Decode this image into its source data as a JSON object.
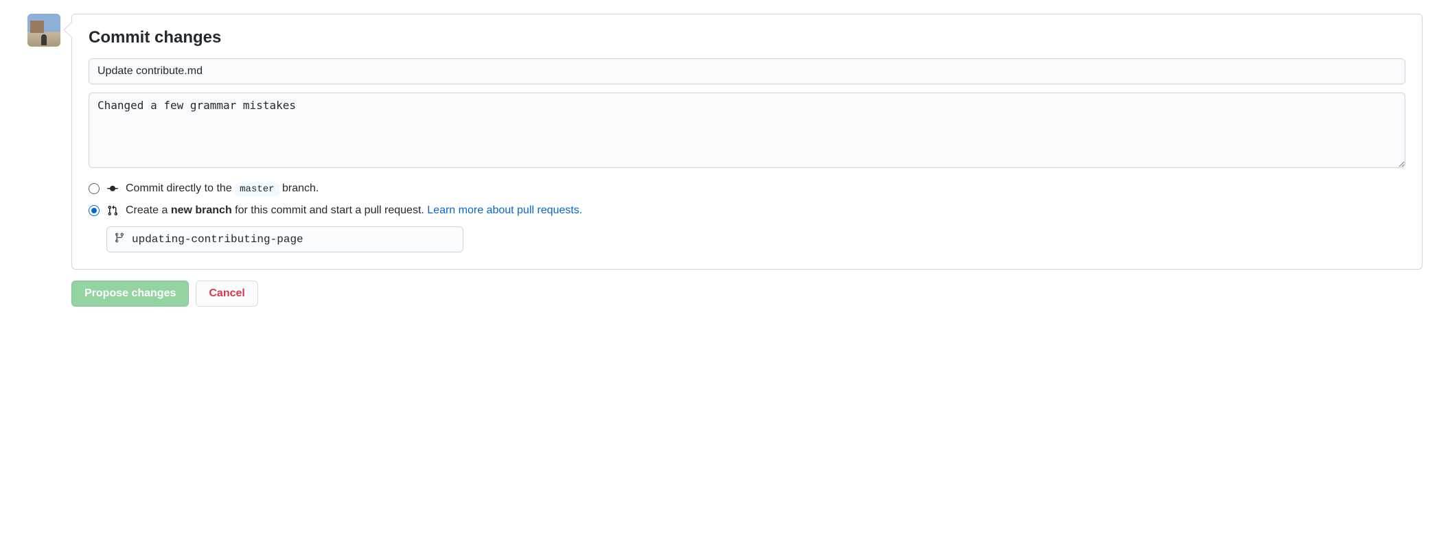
{
  "header": {
    "title": "Commit changes"
  },
  "form": {
    "summary_value": "Update contribute.md",
    "description_value": "Changed a few grammar mistakes"
  },
  "options": {
    "direct": {
      "prefix": "Commit directly to the ",
      "branch_code": "master",
      "suffix": " branch."
    },
    "newbranch": {
      "prefix": "Create a ",
      "strong": "new branch",
      "middle": " for this commit and start a pull request. ",
      "link": "Learn more about pull requests."
    },
    "branch_name_value": "updating-contributing-page"
  },
  "buttons": {
    "propose": "Propose changes",
    "cancel": "Cancel"
  }
}
